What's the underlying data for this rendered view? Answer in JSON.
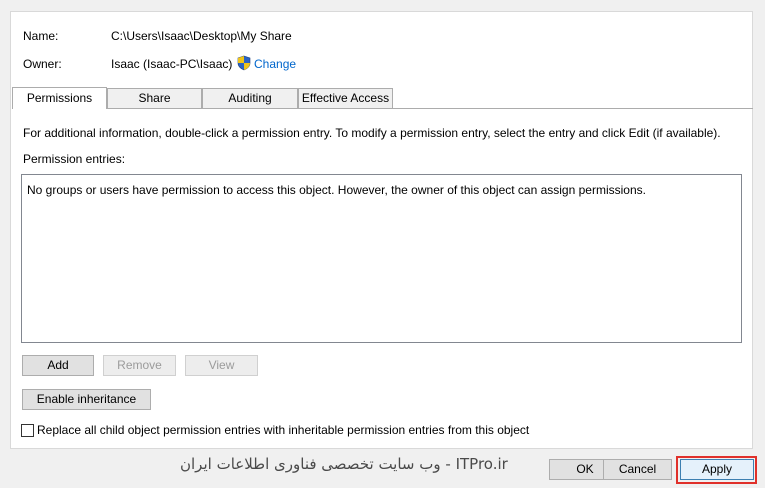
{
  "info": {
    "name_label": "Name:",
    "name_value": "C:\\Users\\Isaac\\Desktop\\My Share",
    "owner_label": "Owner:",
    "owner_value": "Isaac (Isaac-PC\\Isaac)",
    "change_link": "Change",
    "shield_icon": "uac-shield-icon"
  },
  "tabs": [
    {
      "label": "Permissions",
      "active": true
    },
    {
      "label": "Share",
      "active": false
    },
    {
      "label": "Auditing",
      "active": false
    },
    {
      "label": "Effective Access",
      "active": false
    }
  ],
  "permissions": {
    "info_text": "For additional information, double-click a permission entry. To modify a permission entry, select the entry and click Edit (if available).",
    "entries_label": "Permission entries:",
    "empty_message": "No groups or users have permission to access this object. However, the owner of this object can assign permissions.",
    "add_button": "Add",
    "remove_button": "Remove",
    "view_button": "View",
    "enable_inheritance_button": "Enable inheritance",
    "replace_checkbox_label": "Replace all child object permission entries with inheritable permission entries from this object",
    "replace_checked": false
  },
  "footer": {
    "ok_button": "OK",
    "cancel_button": "Cancel",
    "apply_button": "Apply",
    "highlight_color": "#e0302a"
  },
  "watermark": "ITPro.ir - وب سایت تخصصی فناوری اطلاعات ایران"
}
